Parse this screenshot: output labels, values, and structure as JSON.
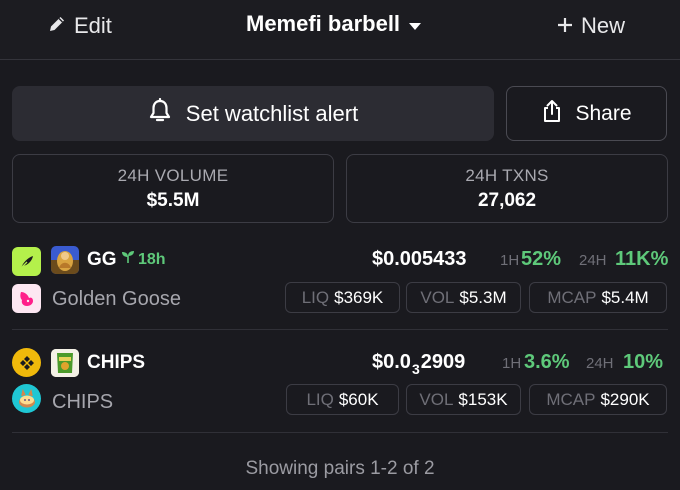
{
  "header": {
    "edit_label": "Edit",
    "watchlist_name": "Memefi barbell",
    "new_label": "New"
  },
  "actions": {
    "alert_label": "Set watchlist alert",
    "share_label": "Share"
  },
  "stats": [
    {
      "label": "24H VOLUME",
      "value": "$5.5M"
    },
    {
      "label": "24H TXNS",
      "value": "27,062"
    }
  ],
  "pairs": [
    {
      "symbol": "GG",
      "age": "18h",
      "name": "Golden Goose",
      "chain": "Sei",
      "dex": "Uniswap",
      "price": "$0.005433",
      "change_1h_label": "1H",
      "change_1h": "52%",
      "change_24h_label": "24H",
      "change_24h": "11K%",
      "liq_label": "LIQ",
      "liq": "$369K",
      "vol_label": "VOL",
      "vol": "$5.3M",
      "mcap_label": "MCAP",
      "mcap": "$5.4M",
      "icons": {
        "chain": "sei-chain-icon",
        "dex": "uniswap-icon",
        "token": "golden-goose-token-logo"
      }
    },
    {
      "symbol": "CHIPS",
      "name": "CHIPS",
      "chain": "BNB Chain",
      "dex": "PancakeSwap",
      "price_prefix": "$0.0",
      "price_zeros": "3",
      "price_digits": "2909",
      "change_1h_label": "1H",
      "change_1h": "3.6%",
      "change_24h_label": "24H",
      "change_24h": "10%",
      "liq_label": "LIQ",
      "liq": "$60K",
      "vol_label": "VOL",
      "vol": "$153K",
      "mcap_label": "MCAP",
      "mcap": "$290K",
      "icons": {
        "chain": "bnb-chain-icon",
        "dex": "pancakeswap-icon",
        "token": "chips-token-logo"
      }
    }
  ],
  "footer": {
    "text": "Showing pairs 1-2 of 2"
  },
  "colors": {
    "background": "#1a1a1f",
    "positive": "#5ec97a",
    "sei": "#b4f04b",
    "uniswap": "#ff1f8a",
    "bnb": "#f0b90b",
    "pancake": "#1fc7d4"
  }
}
